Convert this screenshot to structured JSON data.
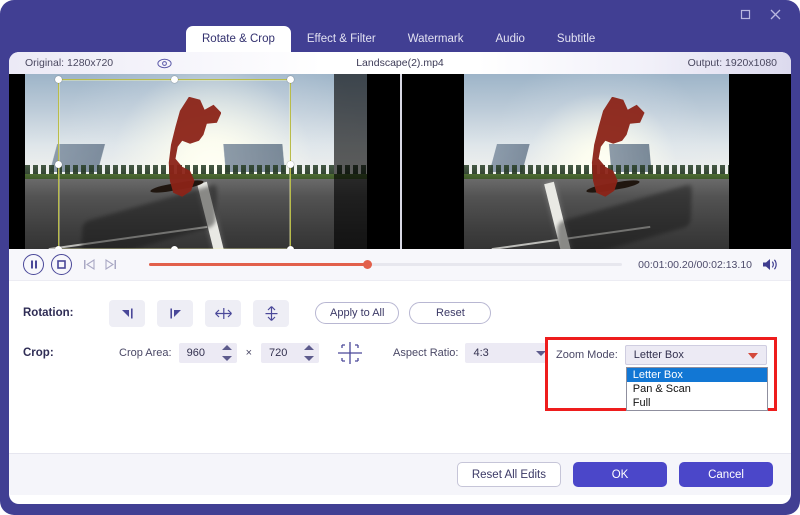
{
  "window": {
    "maximize_label": "Maximize",
    "close_label": "Close"
  },
  "tabs": [
    {
      "label": "Rotate & Crop",
      "active": true
    },
    {
      "label": "Effect & Filter",
      "active": false
    },
    {
      "label": "Watermark",
      "active": false
    },
    {
      "label": "Audio",
      "active": false
    },
    {
      "label": "Subtitle",
      "active": false
    }
  ],
  "info": {
    "original": "Original: 1280x720",
    "filename": "Landscape(2).mp4",
    "output": "Output: 1920x1080",
    "eye_icon": "eye-icon"
  },
  "player": {
    "pause_icon": "pause-icon",
    "stop_icon": "stop-icon",
    "prev_frame_icon": "previous-frame-icon",
    "next_frame_icon": "next-frame-icon",
    "volume_icon": "volume-icon",
    "time": "00:01:00.20/00:02:13.10",
    "progress_percent": 46
  },
  "rotation": {
    "label": "Rotation:",
    "buttons": [
      {
        "name": "rotate-left-icon",
        "title": "Rotate Left"
      },
      {
        "name": "rotate-right-icon",
        "title": "Rotate Right"
      },
      {
        "name": "flip-horizontal-icon",
        "title": "Flip Horizontal"
      },
      {
        "name": "flip-vertical-icon",
        "title": "Flip Vertical"
      }
    ],
    "apply_to_all": "Apply to All",
    "reset": "Reset"
  },
  "crop": {
    "label": "Crop:",
    "area_label": "Crop Area:",
    "width": "960",
    "height": "720",
    "multiply": "×",
    "crop_tool_icon": "crop-frame-icon",
    "aspect_ratio_label": "Aspect Ratio:",
    "aspect_ratio_value": "4:3"
  },
  "zoom_mode": {
    "label": "Zoom Mode:",
    "value": "Letter Box",
    "options": [
      {
        "label": "Letter Box",
        "selected": true
      },
      {
        "label": "Pan & Scan",
        "selected": false
      },
      {
        "label": "Full",
        "selected": false
      }
    ],
    "highlight_color": "#ee1d1d"
  },
  "footer": {
    "reset_all_edits": "Reset All Edits",
    "ok": "OK",
    "cancel": "Cancel"
  },
  "colors": {
    "brand_purple": "#413F93",
    "primary_button": "#4B47C9",
    "progress": "#E2604B",
    "crop_border": "#B9BC4A",
    "dropdown_highlight": "#1277D4"
  }
}
